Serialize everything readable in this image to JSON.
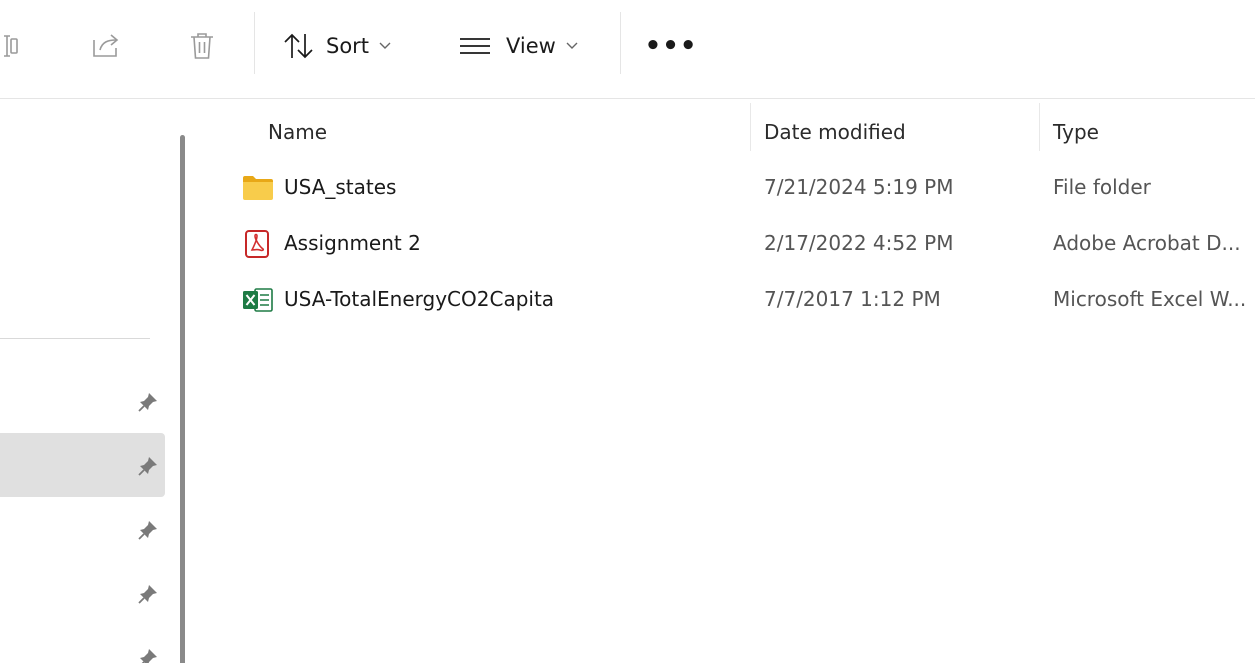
{
  "toolbar": {
    "sort_label": "Sort",
    "view_label": "View",
    "more_label": "•••"
  },
  "columns": {
    "name": "Name",
    "date_modified": "Date modified",
    "type": "Type"
  },
  "files": [
    {
      "name": "USA_states",
      "date": "7/21/2024 5:19 PM",
      "type": "File folder",
      "icon": "folder-icon"
    },
    {
      "name": "Assignment 2",
      "date": "2/17/2022 4:52 PM",
      "type": "Adobe Acrobat D...",
      "icon": "pdf-icon"
    },
    {
      "name": "USA-TotalEnergyCO2Capita",
      "date": "7/7/2017 1:12 PM",
      "type": "Microsoft Excel W...",
      "icon": "excel-icon"
    }
  ],
  "colors": {
    "folder": "#F4C542",
    "pdf": "#D32F2F",
    "excel": "#1E7B45",
    "selected_nav": "#E0E0E0"
  }
}
